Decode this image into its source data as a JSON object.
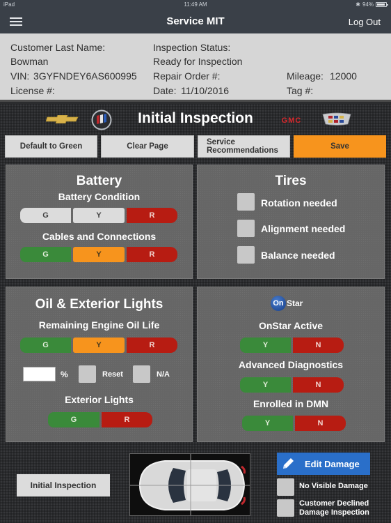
{
  "status_bar": {
    "device": "iPad",
    "time": "11:49 AM",
    "battery": "94%"
  },
  "nav": {
    "title": "Service MIT",
    "logout_label": "Log Out"
  },
  "customer_info": {
    "last_name_label": "Customer Last Name:",
    "last_name": "Bowman",
    "vin_label": "VIN:",
    "vin": "3GYFNDEY6AS600995",
    "license_label": "License #:",
    "license": "",
    "inspection_status_label": "Inspection Status:",
    "inspection_status": "Ready for Inspection",
    "repair_order_label": "Repair Order #:",
    "repair_order": "",
    "date_label": "Date:",
    "date": "11/10/2016",
    "mileage_label": "Mileage:",
    "mileage": "12000",
    "tag_label": "Tag #:",
    "tag": ""
  },
  "page": {
    "title": "Initial Inspection",
    "brand_logos": [
      "chevrolet-logo",
      "buick-logo",
      "gmc-logo",
      "cadillac-logo"
    ]
  },
  "toolbar": {
    "default_green_label": "Default to Green",
    "clear_page_label": "Clear Page",
    "service_recs_label_1": "Service",
    "service_recs_label_2": "Recommendations",
    "save_label": "Save"
  },
  "battery": {
    "title": "Battery",
    "condition_label": "Battery Condition",
    "condition_selected": "R",
    "cables_label": "Cables and Connections",
    "cables_selected": "none",
    "options": [
      "G",
      "Y",
      "R"
    ]
  },
  "tires": {
    "title": "Tires",
    "items": [
      {
        "label": "Rotation needed",
        "checked": false
      },
      {
        "label": "Alignment needed",
        "checked": false
      },
      {
        "label": "Balance needed",
        "checked": false
      }
    ]
  },
  "oil_lights": {
    "title": "Oil & Exterior Lights",
    "oil_life_label": "Remaining Engine Oil Life",
    "oil_options": [
      "G",
      "Y",
      "R"
    ],
    "percent_value": "",
    "percent_symbol": "%",
    "reset_label": "Reset",
    "na_label": "N/A",
    "exterior_lights_label": "Exterior Lights",
    "lights_options": [
      "G",
      "R"
    ]
  },
  "onstar": {
    "logo_text_1": "On",
    "logo_text_2": "Star",
    "active_label": "OnStar Active",
    "diagnostics_label": "Advanced Diagnostics",
    "dmn_label": "Enrolled in DMN",
    "options": [
      "Y",
      "N"
    ]
  },
  "damage": {
    "initial_inspection_label": "Initial Inspection",
    "edit_damage_label": "Edit Damage",
    "no_visible_label": "No Visible Damage",
    "declined_label_1": "Customer Declined",
    "declined_label_2": "Damage Inspection"
  },
  "colors": {
    "green": "#3a8a3a",
    "yellow": "#f7941d",
    "red": "#b71c12",
    "unselected": "#dcdcdc",
    "edit_blue": "#2a6fc9",
    "nav_bg": "#3a4048"
  }
}
